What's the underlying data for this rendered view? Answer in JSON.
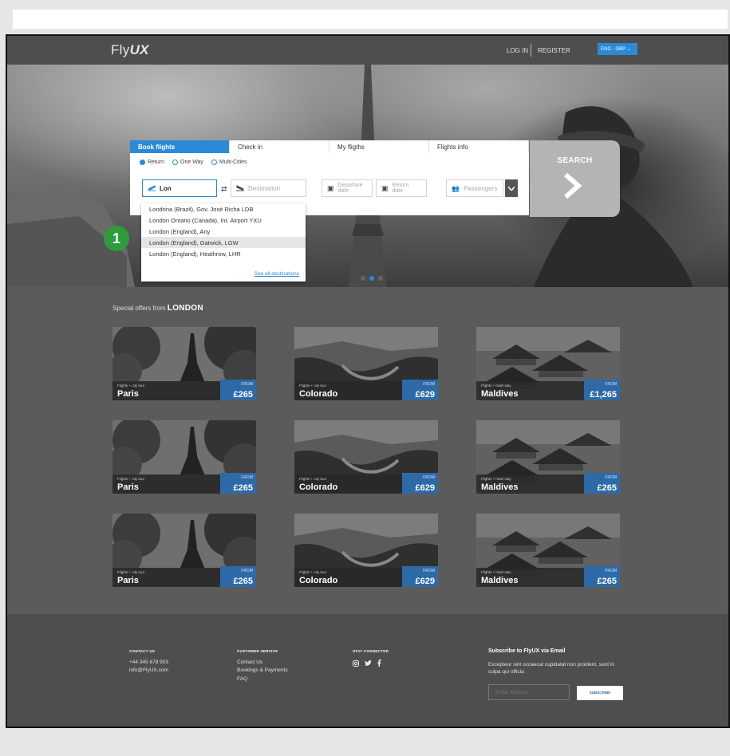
{
  "header": {
    "logo_prefix": "Fly",
    "logo_suffix": "UX",
    "login": "LOG IN",
    "register": "REGISTER",
    "language": "ENG - GBP"
  },
  "booking": {
    "tabs": [
      "Book flights",
      "Check in",
      "My fligths",
      "Flights info"
    ],
    "trip_types": [
      "Return",
      "One Way",
      "Multi-Cities"
    ],
    "origin_value": "Lon",
    "destination_placeholder": "Destination",
    "departure_placeholder": [
      "Departure",
      "date"
    ],
    "return_placeholder": [
      "Return",
      "date"
    ],
    "passengers_placeholder": "Passengers",
    "search_label": "SEARCH"
  },
  "dropdown": {
    "items": [
      "Londrina (Brazil), Gov. José Richa LDB",
      "London Ontario (Canada), Int. Airport YXU",
      "London (England), Any",
      "London (England), Gatwick, LGW",
      "London (England), Heathrow, LHR"
    ],
    "see_all": "See all destinations"
  },
  "annotation": {
    "badge": "1"
  },
  "offers": {
    "prefix": "Special offers from",
    "city": "LONDON",
    "from_label": "FROM",
    "cards": [
      {
        "sub": "Flights + city tour",
        "city": "Paris",
        "price": "£265"
      },
      {
        "sub": "Flights + city tour",
        "city": "Colorado",
        "price": "£629"
      },
      {
        "sub": "Flights + hotel stay",
        "city": "Maldives",
        "price": "£1,265"
      },
      {
        "sub": "Flights + city tour",
        "city": "Paris",
        "price": "£265"
      },
      {
        "sub": "Flights + city tour",
        "city": "Colorado",
        "price": "£629"
      },
      {
        "sub": "Flights + hotel stay",
        "city": "Maldives",
        "price": "£265"
      },
      {
        "sub": "Flights + city tour",
        "city": "Paris",
        "price": "£265"
      },
      {
        "sub": "Flights + city tour",
        "city": "Colorado",
        "price": "£629"
      },
      {
        "sub": "Flights + hotel stay",
        "city": "Maldives",
        "price": "£265"
      }
    ]
  },
  "footer": {
    "contact_heading": "CONTACT US",
    "phone": "+44 345 678 903",
    "email": "info@FlyUX.com",
    "service_heading": "CUSTOMER SERVICE",
    "service_links": [
      "Contact Us",
      "Bookings & Payments",
      "FAQ"
    ],
    "social_heading": "STAY CONNECTED",
    "social_icons": [
      "instagram-icon",
      "twitter-icon",
      "facebook-icon"
    ],
    "subscribe_title": "Subscribe to FlyUX via Email",
    "subscribe_text": "Excepteur sint occaecat cupidatat non proident, sunt in culpa qui officia",
    "email_placeholder": "Email Address",
    "subscribe_button": "SUBSCRIBE"
  },
  "colors": {
    "accent": "#2a8ad8",
    "badge": "#2e9c3b",
    "price": "#2e6aa8"
  }
}
